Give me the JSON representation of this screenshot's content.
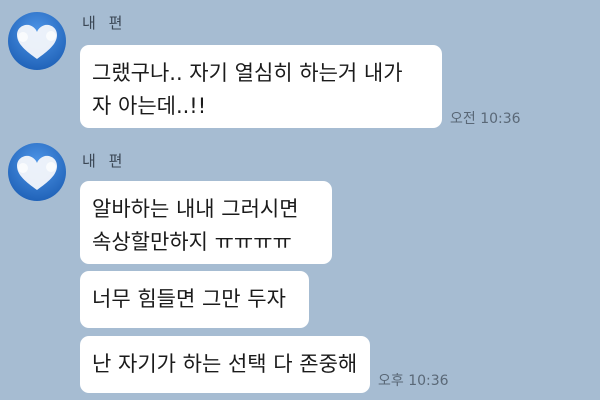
{
  "chat": {
    "background_color": "#a6bcd2",
    "bubble_color": "#ffffff",
    "groups": [
      {
        "sender": "내 편",
        "avatar_icon": "heart-cloud-icon",
        "messages": [
          {
            "lines": [
              "그랬구나.. 자기 열심히 하는거 내가",
              "자 아는데..!!"
            ]
          }
        ],
        "time": "오전 10:36"
      },
      {
        "sender": "내 편",
        "avatar_icon": "heart-cloud-icon",
        "messages": [
          {
            "lines": [
              "알바하는 내내 그러시면",
              "속상할만하지 ㅠㅠㅠㅠ"
            ]
          },
          {
            "lines": [
              "너무 힘들면 그만 두자"
            ]
          },
          {
            "lines": [
              "난 자기가 하는 선택 다 존중해"
            ]
          }
        ],
        "time": "오후 10:36"
      }
    ]
  }
}
